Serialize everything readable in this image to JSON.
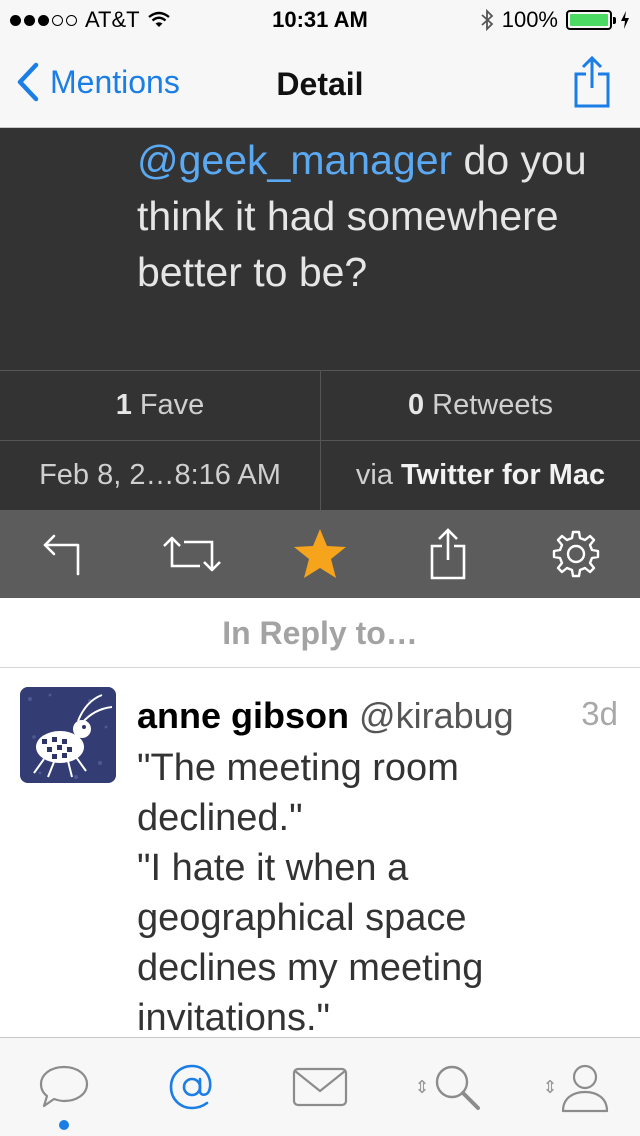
{
  "status_bar": {
    "carrier": "AT&T",
    "time": "10:31 AM",
    "battery_percent": "100%",
    "battery_level": 1.0,
    "signal_bars": 3,
    "signal_total": 5
  },
  "nav": {
    "back_label": "Mentions",
    "title": "Detail"
  },
  "tweet": {
    "mention": "@geek_manager",
    "text": " do you think it had somewhere better to be?",
    "fave_count": "1",
    "fave_label": "Fave",
    "retweet_count": "0",
    "retweet_label": "Retweets",
    "date": "Feb 8, 2…8:16 AM",
    "via_prefix": "via",
    "via_app": "Twitter for Mac"
  },
  "actions": {
    "icons": [
      "reply-icon",
      "retweet-icon",
      "star-icon",
      "share-icon",
      "gear-icon"
    ],
    "star_color": "#f7a41d"
  },
  "reply_section": {
    "header": "In Reply to…"
  },
  "reply_tweet": {
    "name": "anne gibson",
    "handle": "@kirabug",
    "time": "3d",
    "lines": [
      "\"The meeting room",
      "declined.\"",
      "\"I hate it when a",
      "geographical space",
      "declines my meeting",
      "invitations.\""
    ]
  },
  "tab_bar": {
    "tabs": [
      "timeline-tab",
      "mentions-tab",
      "messages-tab",
      "search-tab",
      "profile-tab"
    ],
    "active_tab": "mentions-tab",
    "accent_color": "#1a7ee6"
  },
  "colors": {
    "accent": "#1a7ee6",
    "dark_bg": "#333333",
    "toolbar_bg": "#5c5c5c",
    "battery_green": "#4cd964"
  }
}
